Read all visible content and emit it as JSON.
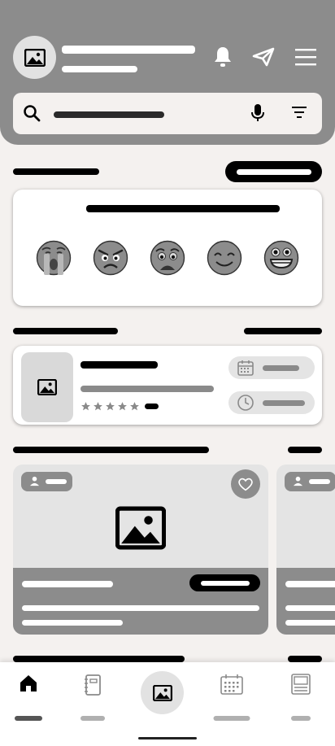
{
  "header": {
    "avatar_icon": "image-placeholder-icon",
    "icons": [
      "bell-icon",
      "send-icon",
      "menu-icon"
    ]
  },
  "search": {
    "placeholder": "",
    "icons": [
      "search-icon",
      "microphone-icon",
      "filter-icon"
    ]
  },
  "mood": {
    "emojis": [
      "crying-face-icon",
      "angry-face-icon",
      "worried-face-icon",
      "smiling-face-icon",
      "grinning-face-icon"
    ]
  },
  "appointment": {
    "rating": 5,
    "rating_max": 5,
    "chips": [
      "calendar-icon",
      "clock-icon"
    ]
  },
  "featured": {
    "cards": 2,
    "icons": [
      "user-icon",
      "heart-icon",
      "image-placeholder-icon"
    ]
  },
  "nav": {
    "items": [
      "home-icon",
      "notebook-icon",
      "image-icon",
      "calendar-icon",
      "list-icon"
    ],
    "active_index": 0
  },
  "colors": {
    "header": "#8c8c8c",
    "background": "#f4f1ef",
    "accent": "#000000"
  }
}
